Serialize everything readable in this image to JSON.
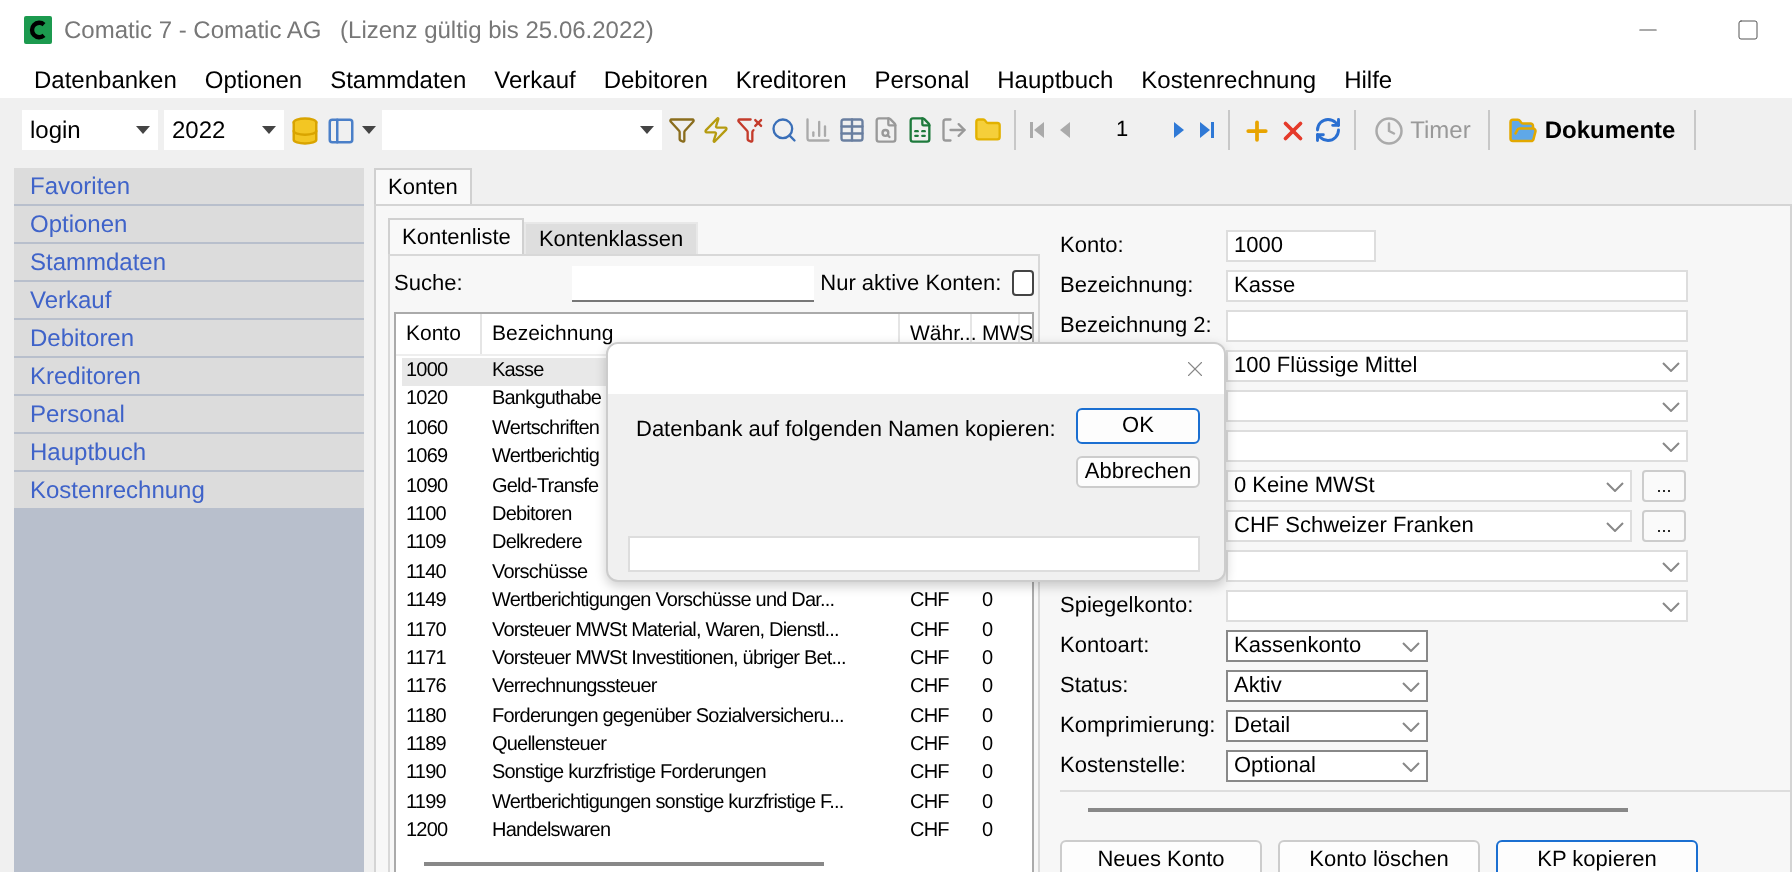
{
  "window": {
    "title": "Comatic 7 - Comatic AG",
    "license": "(Lizenz gültig bis 25.06.2022)"
  },
  "menu": [
    "Datenbanken",
    "Optionen",
    "Stammdaten",
    "Verkauf",
    "Debitoren",
    "Kreditoren",
    "Personal",
    "Hauptbuch",
    "Kostenrechnung",
    "Hilfe"
  ],
  "toolbar": {
    "user": "login",
    "year": "2022",
    "page": "1",
    "timer": {
      "label": "Timer",
      "disabled": true
    },
    "documents": "Dokumente"
  },
  "sidebar": {
    "items": [
      "Favoriten",
      "Optionen",
      "Stammdaten",
      "Verkauf",
      "Debitoren",
      "Kreditoren",
      "Personal",
      "Hauptbuch",
      "Kostenrechnung"
    ]
  },
  "tabs": [
    {
      "label": "Konten",
      "selected": true
    }
  ],
  "subtabs": [
    {
      "label": "Kontenliste",
      "selected": true
    },
    {
      "label": "Kontenklassen",
      "selected": false
    }
  ],
  "search": {
    "label": "Suche:"
  },
  "only_active": {
    "label": "Nur aktive Konten:",
    "checked": false
  },
  "table": {
    "columns": [
      "Konto",
      "Bezeichnung",
      "Währ...",
      "MWS"
    ],
    "rows": [
      {
        "konto": "1000",
        "name": "Kasse",
        "selected": true
      },
      {
        "konto": "1020",
        "name": "Bankguthabe",
        "selected": false
      },
      {
        "konto": "1060",
        "name": "Wertschriften",
        "selected": false
      },
      {
        "konto": "1069",
        "name": "Wertberichtig",
        "selected": false
      },
      {
        "konto": "1090",
        "name": "Geld-Transfe",
        "selected": false
      },
      {
        "konto": "1100",
        "name": "Debitoren",
        "selected": false
      },
      {
        "konto": "1109",
        "name": "Delkredere",
        "selected": false
      },
      {
        "konto": "1140",
        "name": "Vorschüsse",
        "selected": false
      },
      {
        "konto": "1149",
        "name": "Wertberichtigungen Vorschüsse und Dar...",
        "currency": "CHF",
        "mws": "0",
        "selected": false
      },
      {
        "konto": "1170",
        "name": "Vorsteuer MWSt Material, Waren, Dienstl...",
        "currency": "CHF",
        "mws": "0",
        "selected": false
      },
      {
        "konto": "1171",
        "name": "Vorsteuer MWSt Investitionen, übriger Bet...",
        "currency": "CHF",
        "mws": "0",
        "selected": false
      },
      {
        "konto": "1176",
        "name": "Verrechnungssteuer",
        "currency": "CHF",
        "mws": "0",
        "selected": false
      },
      {
        "konto": "1180",
        "name": "Forderungen gegenüber Sozialversicheru...",
        "currency": "CHF",
        "mws": "0",
        "selected": false
      },
      {
        "konto": "1189",
        "name": "Quellensteuer",
        "currency": "CHF",
        "mws": "0",
        "selected": false
      },
      {
        "konto": "1190",
        "name": "Sonstige kurzfristige Forderungen",
        "currency": "CHF",
        "mws": "0",
        "selected": false
      },
      {
        "konto": "1199",
        "name": "Wertberichtigungen sonstige kurzfristige F...",
        "currency": "CHF",
        "mws": "0",
        "selected": false
      },
      {
        "konto": "1200",
        "name": "Handelswaren",
        "currency": "CHF",
        "mws": "0",
        "selected": false
      }
    ]
  },
  "form": [
    {
      "label": "Konto:",
      "value": "1000",
      "kind": "short_text"
    },
    {
      "label": "Bezeichnung:",
      "value": "Kasse",
      "kind": "text"
    },
    {
      "label": "Bezeichnung 2:",
      "kind": "text"
    },
    {
      "value": "100 Flüssige Mittel",
      "kind": "select"
    },
    {
      "kind": "select"
    },
    {
      "kind": "select"
    },
    {
      "value": "0 Keine MWSt",
      "kind": "select_more",
      "more": "..."
    },
    {
      "value": "CHF Schweizer Franken",
      "kind": "select_more",
      "more": "..."
    },
    {
      "kind": "select"
    },
    {
      "label": "Spiegelkonto:",
      "kind": "select"
    },
    {
      "label": "Kontoart:",
      "value": "Kassenkonto",
      "kind": "short_select"
    },
    {
      "label": "Status:",
      "value": "Aktiv",
      "kind": "short_select"
    },
    {
      "label": "Komprimierung:",
      "value": "Detail",
      "kind": "short_select"
    },
    {
      "label": "Kostenstelle:",
      "value": "Optional",
      "kind": "short_select"
    }
  ],
  "buttons": [
    {
      "label": "Neues Konto",
      "default": false
    },
    {
      "label": "Konto löschen",
      "default": false
    },
    {
      "label": "KP kopieren",
      "default": true
    }
  ],
  "dialog": {
    "message": "Datenbank auf folgenden Namen kopieren:",
    "buttons": [
      {
        "label": "OK",
        "default": true
      },
      {
        "label": "Abbrechen",
        "default": false
      }
    ]
  }
}
